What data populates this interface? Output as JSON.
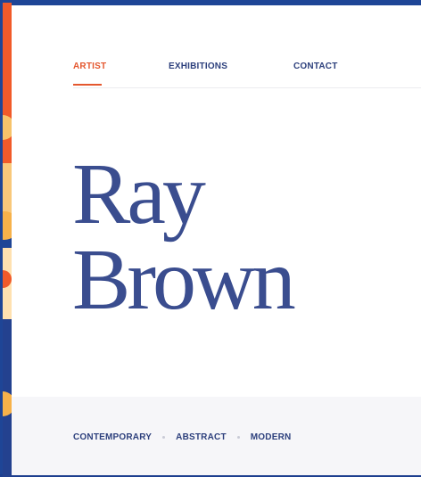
{
  "nav": {
    "items": [
      {
        "label": "ARTIST",
        "active": true
      },
      {
        "label": "EXHIBITIONS",
        "active": false
      },
      {
        "label": "CONTACT",
        "active": false
      }
    ],
    "accent_color": "#e4572e"
  },
  "hero": {
    "first_name": "Ray",
    "last_name": "Brown",
    "color": "#3a4d8f"
  },
  "tags": [
    "CONTEMPORARY",
    "ABSTRACT",
    "MODERN"
  ],
  "theme": {
    "frame_color": "#1e4596",
    "tag_bar_bg": "#f6f6f9"
  }
}
